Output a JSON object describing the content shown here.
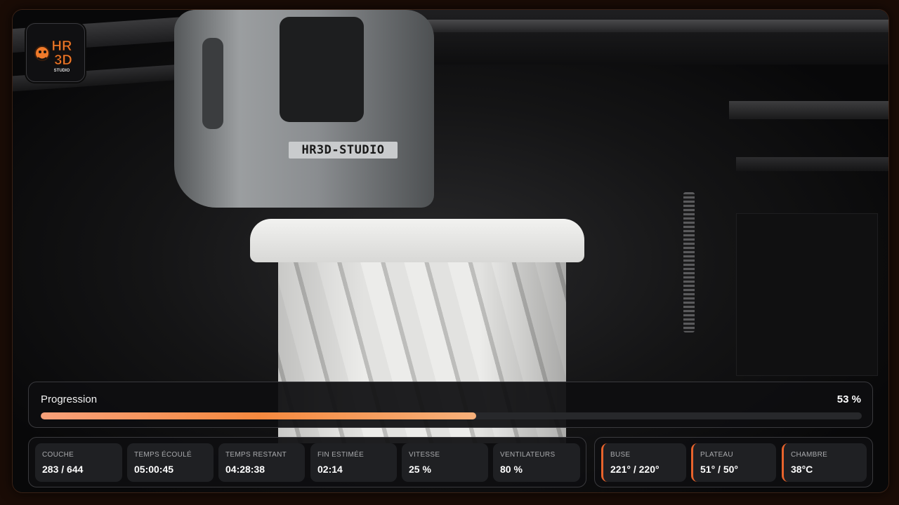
{
  "logo": {
    "text_top": "HR",
    "text_bottom": "3D",
    "text_sub": "STUDIO"
  },
  "toolhead_label": "HR3D-STUDIO",
  "progress": {
    "title": "Progression",
    "percent_label": "53 %",
    "percent_value": 53,
    "accent_color": "#f5893f"
  },
  "stats": [
    {
      "label": "COUCHE",
      "value": "283 / 644"
    },
    {
      "label": "TEMPS ÉCOULÉ",
      "value": "05:00:45"
    },
    {
      "label": "TEMPS RESTANT",
      "value": "04:28:38"
    },
    {
      "label": "FIN ESTIMÉE",
      "value": "02:14"
    },
    {
      "label": "VITESSE",
      "value": "25 %"
    },
    {
      "label": "VENTILATEURS",
      "value": "80 %"
    }
  ],
  "temps": [
    {
      "label": "BUSE",
      "value": "221° / 220°"
    },
    {
      "label": "PLATEAU",
      "value": "51° / 50°"
    },
    {
      "label": "CHAMBRE",
      "value": "38°C"
    }
  ],
  "temp_accent_color": "#e8632c"
}
